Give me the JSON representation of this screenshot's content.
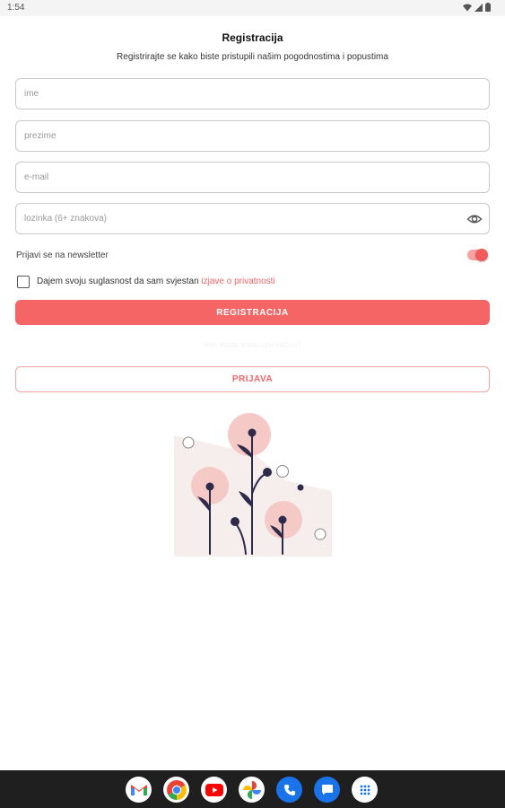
{
  "status_bar": {
    "time": "1:54",
    "icons": [
      "wifi-icon",
      "signal-icon",
      "battery-icon"
    ]
  },
  "header": {
    "title": "Registracija",
    "subtitle": "Registrirajte se kako biste pristupili našim pogodnostima i popustima"
  },
  "form": {
    "first_name_placeholder": "ime",
    "last_name_placeholder": "prezime",
    "email_placeholder": "e-mail",
    "password_placeholder": "lozinka (6+ znakova)",
    "newsletter_label": "Prijavi se na newsletter",
    "newsletter_enabled": true,
    "consent_checked": false,
    "consent_text": "Dajem svoju suglasnost da sam svjestan",
    "consent_link": "izjave o privatnosti"
  },
  "actions": {
    "register_label": "REGISTRACIJA",
    "divider_text": "Već imate korisnički račun?",
    "login_label": "PRIJAVA"
  },
  "dock": {
    "apps": [
      "gmail-icon",
      "chrome-icon",
      "youtube-icon",
      "photos-icon",
      "phone-icon",
      "messages-icon",
      "app-drawer-icon"
    ]
  },
  "colors": {
    "accent": "#f56565",
    "accent_light": "#f5c9c6",
    "illustration_dark": "#2e2b4a",
    "illustration_bg": "#f6eeec"
  }
}
